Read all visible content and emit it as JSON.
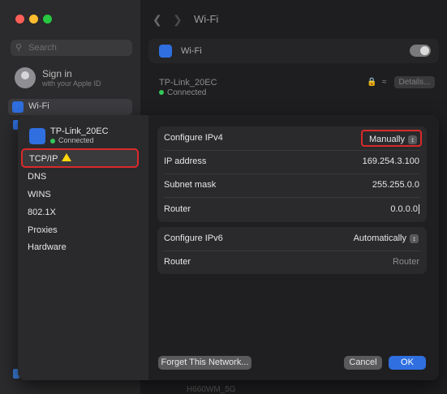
{
  "app": {
    "window_title": "Wi-Fi"
  },
  "sidebar": {
    "search_placeholder": "Search",
    "sign_in_title": "Sign in",
    "sign_in_subtitle": "with your Apple ID",
    "selected_item": "Wi-Fi"
  },
  "main": {
    "wifi_label": "Wi-Fi",
    "network_name": "TP-Link_20EC",
    "network_status": "Connected",
    "details_label": "Details...",
    "bottom_network": "H660WM_5G"
  },
  "dialog": {
    "network_name": "TP-Link_20EC",
    "network_status": "Connected",
    "sidebar_items": [
      {
        "label": "TCP/IP"
      },
      {
        "label": "DNS"
      },
      {
        "label": "WINS"
      },
      {
        "label": "802.1X"
      },
      {
        "label": "Proxies"
      },
      {
        "label": "Hardware"
      }
    ],
    "ipv4": {
      "configure_label": "Configure IPv4",
      "configure_value": "Manually",
      "ip_label": "IP address",
      "ip_value": "169.254.3.100",
      "subnet_label": "Subnet mask",
      "subnet_value": "255.255.0.0",
      "router_label": "Router",
      "router_value": "0.0.0.0"
    },
    "ipv6": {
      "configure_label": "Configure IPv6",
      "configure_value": "Automatically",
      "router_label": "Router",
      "router_value": "Router"
    },
    "forget_label": "Forget This Network...",
    "cancel_label": "Cancel",
    "ok_label": "OK"
  },
  "colors": {
    "accent": "#2f6fe0",
    "highlight_border": "#d92a2a",
    "connected_green": "#33c759",
    "warning_yellow": "#ffd60a"
  }
}
